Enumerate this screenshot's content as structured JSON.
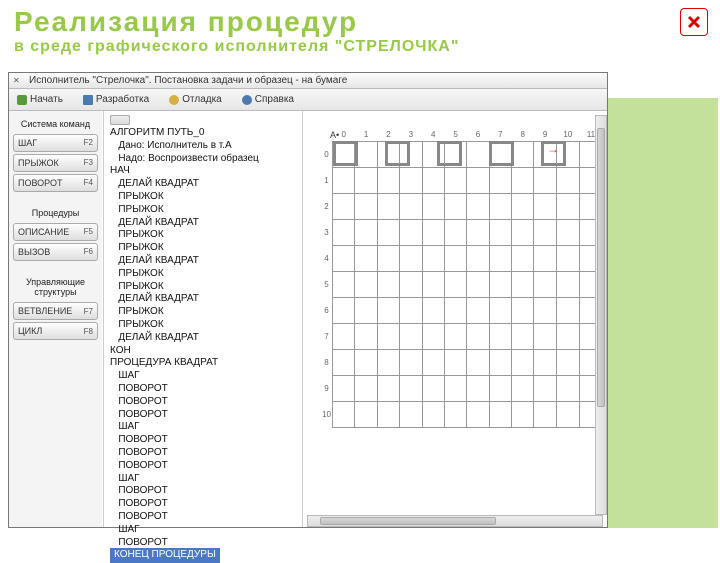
{
  "slide": {
    "title": "Реализация  процедур",
    "subtitle": "в  среде  графического  исполнителя  \"СТРЕЛОЧКА\""
  },
  "app": {
    "window_title": "Исполнитель \"Стрелочка\". Постановка задачи и образец - на бумаге",
    "toolbar": {
      "start": "Начать",
      "dev": "Разработка",
      "debug": "Отладка",
      "help": "Справка"
    },
    "side": {
      "group_commands": "Система\nкоманд",
      "btn_step": "ШАГ",
      "key_step": "F2",
      "btn_jump": "ПРЫЖОК",
      "key_jump": "F3",
      "btn_turn": "ПОВОРОТ",
      "key_turn": "F4",
      "group_proc": "Процедуры",
      "btn_desc": "ОПИСАНИЕ",
      "key_desc": "F5",
      "btn_call": "ВЫЗОВ",
      "key_call": "F6",
      "group_ctrl": "Управляющие\nструктуры",
      "btn_branch": "ВЕТВЛЕНИЕ",
      "key_branch": "F7",
      "btn_loop": "ЦИКЛ",
      "key_loop": "F8"
    },
    "code": [
      "АЛГОРИТМ ПУТЬ_0",
      "   Дано: Исполнитель в т.A",
      "   Надо: Воспроизвести образец",
      "НАЧ",
      "   ДЕЛАЙ КВАДРАТ",
      "   ПРЫЖОК",
      "   ПРЫЖОК",
      "   ДЕЛАЙ КВАДРАТ",
      "   ПРЫЖОК",
      "   ПРЫЖОК",
      "   ДЕЛАЙ КВАДРАТ",
      "   ПРЫЖОК",
      "   ПРЫЖОК",
      "   ДЕЛАЙ КВАДРАТ",
      "   ПРЫЖОК",
      "   ПРЫЖОК",
      "   ДЕЛАЙ КВАДРАТ",
      "КОН",
      "ПРОЦЕДУРА КВАДРАТ",
      "   ШАГ",
      "   ПОВОРОТ",
      "   ПОВОРОТ",
      "   ПОВОРОТ",
      "   ШАГ",
      "   ПОВОРОТ",
      "   ПОВОРОТ",
      "   ПОВОРОТ",
      "   ШАГ",
      "   ПОВОРОТ",
      "   ПОВОРОТ",
      "   ПОВОРОТ",
      "   ШАГ",
      "   ПОВОРОТ"
    ],
    "code_last": "КОНЕЦ ПРОЦЕДУРЫ",
    "grid": {
      "cols": [
        "0",
        "1",
        "2",
        "3",
        "4",
        "5",
        "6",
        "7",
        "8",
        "9",
        "10",
        "11"
      ],
      "rows": [
        "0",
        "1",
        "2",
        "3",
        "4",
        "5",
        "6",
        "7",
        "8",
        "9",
        "10"
      ],
      "a_label": "A",
      "arrow": "→"
    }
  }
}
